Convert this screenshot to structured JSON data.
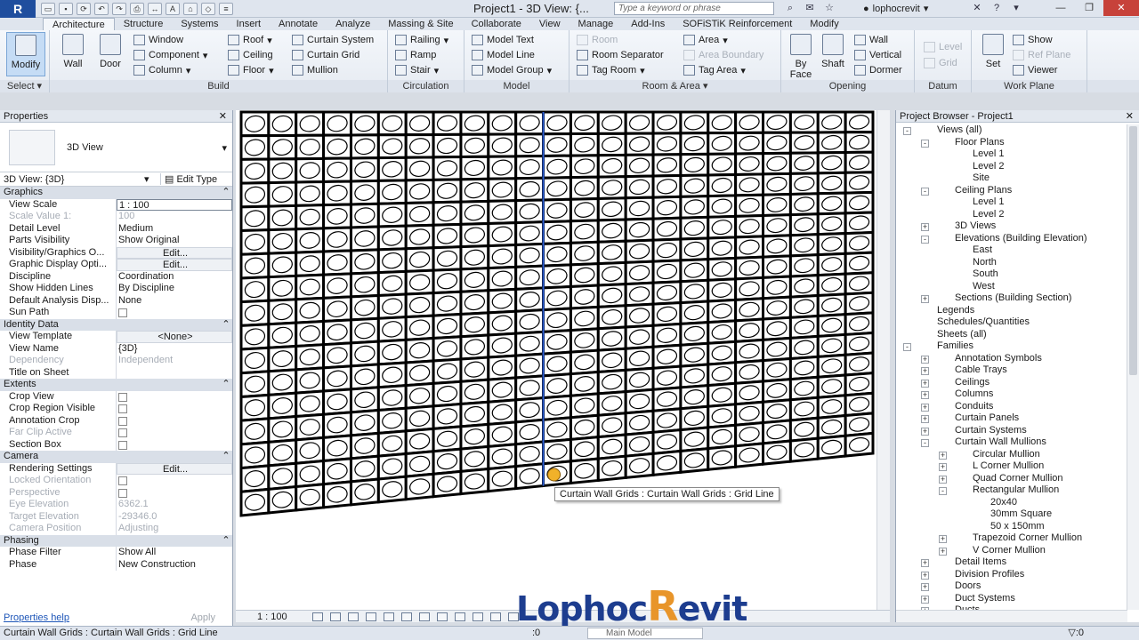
{
  "titlebar": {
    "app_letter": "R",
    "doc_title": "Project1 - 3D View: {...",
    "search_placeholder": "Type a keyword or phrase",
    "user": "lophocrevit"
  },
  "tabs": [
    "Architecture",
    "Structure",
    "Systems",
    "Insert",
    "Annotate",
    "Analyze",
    "Massing & Site",
    "Collaborate",
    "View",
    "Manage",
    "Add-Ins",
    "SOFiSTiK Reinforcement",
    "Modify"
  ],
  "ribbon": {
    "select": {
      "modify": "Modify",
      "label": "Select ▾"
    },
    "build": {
      "label": "Build",
      "wall": "Wall",
      "door": "Door",
      "window": "Window",
      "component": "Component",
      "column": "Column",
      "roof": "Roof",
      "ceiling": "Ceiling",
      "floor": "Floor",
      "curtain_system": "Curtain System",
      "curtain_grid": "Curtain Grid",
      "mullion": "Mullion"
    },
    "circulation": {
      "label": "Circulation",
      "railing": "Railing",
      "ramp": "Ramp",
      "stair": "Stair"
    },
    "model": {
      "label": "Model",
      "model_text": "Model Text",
      "model_line": "Model Line",
      "model_group": "Model Group"
    },
    "room_area": {
      "label": "Room & Area ▾",
      "room": "Room",
      "room_separator": "Room Separator",
      "tag_room": "Tag Room",
      "area": "Area",
      "area_boundary": "Area Boundary",
      "tag_area": "Tag Area"
    },
    "opening": {
      "label": "Opening",
      "by_face": "By Face",
      "shaft": "Shaft",
      "wall": "Wall",
      "vertical": "Vertical",
      "dormer": "Dormer"
    },
    "datum": {
      "label": "Datum",
      "level": "Level",
      "grid": "Grid"
    },
    "work_plane": {
      "label": "Work Plane",
      "set": "Set",
      "show": "Show",
      "ref_plane": "Ref Plane",
      "viewer": "Viewer"
    }
  },
  "properties": {
    "title": "Properties",
    "type_name": "3D View",
    "instance": "3D View: {3D}",
    "edit_type": "Edit Type",
    "rows": [
      {
        "group": "Graphics"
      },
      {
        "k": "View Scale",
        "v": "1 : 100",
        "input": true
      },
      {
        "k": "Scale Value    1:",
        "v": "100",
        "dis": true
      },
      {
        "k": "Detail Level",
        "v": "Medium"
      },
      {
        "k": "Parts Visibility",
        "v": "Show Original"
      },
      {
        "k": "Visibility/Graphics O...",
        "v": "Edit...",
        "btn": true
      },
      {
        "k": "Graphic Display Opti...",
        "v": "Edit...",
        "btn": true
      },
      {
        "k": "Discipline",
        "v": "Coordination"
      },
      {
        "k": "Show Hidden Lines",
        "v": "By Discipline"
      },
      {
        "k": "Default Analysis Disp...",
        "v": "None"
      },
      {
        "k": "Sun Path",
        "v": "",
        "chk": true
      },
      {
        "group": "Identity Data"
      },
      {
        "k": "View Template",
        "v": "<None>",
        "btn": true
      },
      {
        "k": "View Name",
        "v": "{3D}"
      },
      {
        "k": "Dependency",
        "v": "Independent",
        "dis": true
      },
      {
        "k": "Title on Sheet",
        "v": ""
      },
      {
        "group": "Extents"
      },
      {
        "k": "Crop View",
        "v": "",
        "chk": true
      },
      {
        "k": "Crop Region Visible",
        "v": "",
        "chk": true
      },
      {
        "k": "Annotation Crop",
        "v": "",
        "chk": true
      },
      {
        "k": "Far Clip Active",
        "v": "",
        "chk": true,
        "dis": true
      },
      {
        "k": "Section Box",
        "v": "",
        "chk": true
      },
      {
        "group": "Camera"
      },
      {
        "k": "Rendering Settings",
        "v": "Edit...",
        "btn": true
      },
      {
        "k": "Locked Orientation",
        "v": "",
        "chk": true,
        "dis": true
      },
      {
        "k": "Perspective",
        "v": "",
        "chk": true,
        "dis": true
      },
      {
        "k": "Eye Elevation",
        "v": "6362.1",
        "dis": true
      },
      {
        "k": "Target Elevation",
        "v": "-29346.0",
        "dis": true
      },
      {
        "k": "Camera Position",
        "v": "Adjusting",
        "dis": true
      },
      {
        "group": "Phasing"
      },
      {
        "k": "Phase Filter",
        "v": "Show All"
      },
      {
        "k": "Phase",
        "v": "New Construction"
      }
    ],
    "help_link": "Properties help",
    "apply": "Apply"
  },
  "viewport": {
    "tooltip": "Curtain Wall Grids : Curtain Wall Grids : Grid Line",
    "scale": "1 : 100"
  },
  "watermark": {
    "part1": "Lophoc",
    "r": "R",
    "part2": "evit"
  },
  "browser": {
    "title": "Project Browser - Project1",
    "nodes": [
      {
        "t": "Views (all)",
        "d": 1,
        "tog": "-"
      },
      {
        "t": "Floor Plans",
        "d": 2,
        "tog": "-"
      },
      {
        "t": "Level 1",
        "d": 3
      },
      {
        "t": "Level 2",
        "d": 3
      },
      {
        "t": "Site",
        "d": 3
      },
      {
        "t": "Ceiling Plans",
        "d": 2,
        "tog": "-"
      },
      {
        "t": "Level 1",
        "d": 3
      },
      {
        "t": "Level 2",
        "d": 3
      },
      {
        "t": "3D Views",
        "d": 2,
        "tog": "+"
      },
      {
        "t": "Elevations (Building Elevation)",
        "d": 2,
        "tog": "-"
      },
      {
        "t": "East",
        "d": 3
      },
      {
        "t": "North",
        "d": 3
      },
      {
        "t": "South",
        "d": 3
      },
      {
        "t": "West",
        "d": 3
      },
      {
        "t": "Sections (Building Section)",
        "d": 2,
        "tog": "+"
      },
      {
        "t": "Legends",
        "d": 1
      },
      {
        "t": "Schedules/Quantities",
        "d": 1
      },
      {
        "t": "Sheets (all)",
        "d": 1
      },
      {
        "t": "Families",
        "d": 1,
        "tog": "-"
      },
      {
        "t": "Annotation Symbols",
        "d": 2,
        "tog": "+"
      },
      {
        "t": "Cable Trays",
        "d": 2,
        "tog": "+"
      },
      {
        "t": "Ceilings",
        "d": 2,
        "tog": "+"
      },
      {
        "t": "Columns",
        "d": 2,
        "tog": "+"
      },
      {
        "t": "Conduits",
        "d": 2,
        "tog": "+"
      },
      {
        "t": "Curtain Panels",
        "d": 2,
        "tog": "+"
      },
      {
        "t": "Curtain Systems",
        "d": 2,
        "tog": "+"
      },
      {
        "t": "Curtain Wall Mullions",
        "d": 2,
        "tog": "-"
      },
      {
        "t": "Circular Mullion",
        "d": 3,
        "tog": "+"
      },
      {
        "t": "L Corner Mullion",
        "d": 3,
        "tog": "+"
      },
      {
        "t": "Quad Corner Mullion",
        "d": 3,
        "tog": "+"
      },
      {
        "t": "Rectangular Mullion",
        "d": 3,
        "tog": "-"
      },
      {
        "t": "20x40",
        "d": 4
      },
      {
        "t": "30mm Square",
        "d": 4
      },
      {
        "t": "50 x 150mm",
        "d": 4
      },
      {
        "t": "Trapezoid Corner Mullion",
        "d": 3,
        "tog": "+"
      },
      {
        "t": "V Corner Mullion",
        "d": 3,
        "tog": "+"
      },
      {
        "t": "Detail Items",
        "d": 2,
        "tog": "+"
      },
      {
        "t": "Division Profiles",
        "d": 2,
        "tog": "+"
      },
      {
        "t": "Doors",
        "d": 2,
        "tog": "+"
      },
      {
        "t": "Duct Systems",
        "d": 2,
        "tog": "+"
      },
      {
        "t": "Ducts",
        "d": 2,
        "tog": "+"
      }
    ]
  },
  "status": {
    "text": "Curtain Wall Grids : Curtain Wall Grids : Grid Line",
    "zero": ":0",
    "model": "Main Model",
    "filter": "▽:0"
  }
}
